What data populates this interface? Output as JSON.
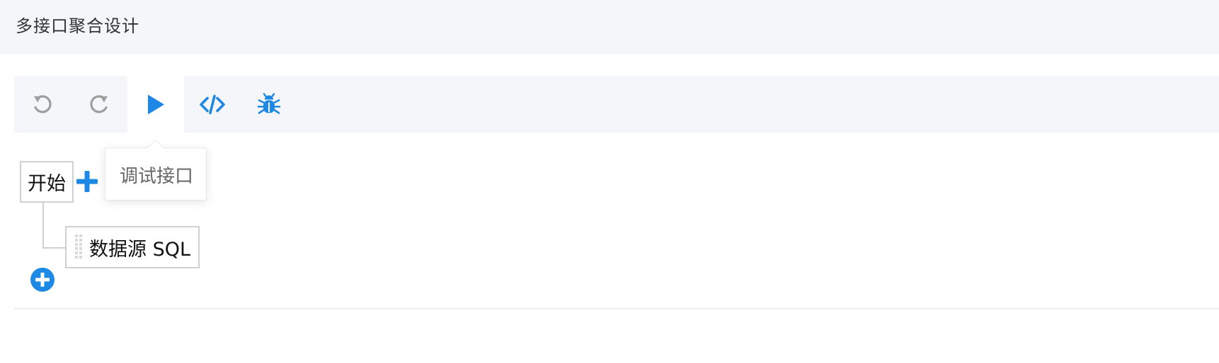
{
  "header": {
    "title": "多接口聚合设计"
  },
  "toolbar": {
    "buttons": [
      {
        "name": "undo",
        "icon": "undo-icon",
        "color": "#9e9e9e"
      },
      {
        "name": "redo",
        "icon": "redo-icon",
        "color": "#9e9e9e"
      },
      {
        "name": "run",
        "icon": "play-icon",
        "color": "#1e88e5",
        "active": true
      },
      {
        "name": "code",
        "icon": "code-icon",
        "color": "#1e88e5"
      },
      {
        "name": "debug",
        "icon": "bug-icon",
        "color": "#1e88e5"
      }
    ]
  },
  "tooltip": {
    "text": "调试接口"
  },
  "flow": {
    "start_label": "开始",
    "nodes": [
      {
        "label": "数据源 SQL"
      }
    ],
    "add_icon": "plus-icon",
    "add_circle_icon": "plus-circle-icon",
    "accent_color": "#1e88e5"
  }
}
